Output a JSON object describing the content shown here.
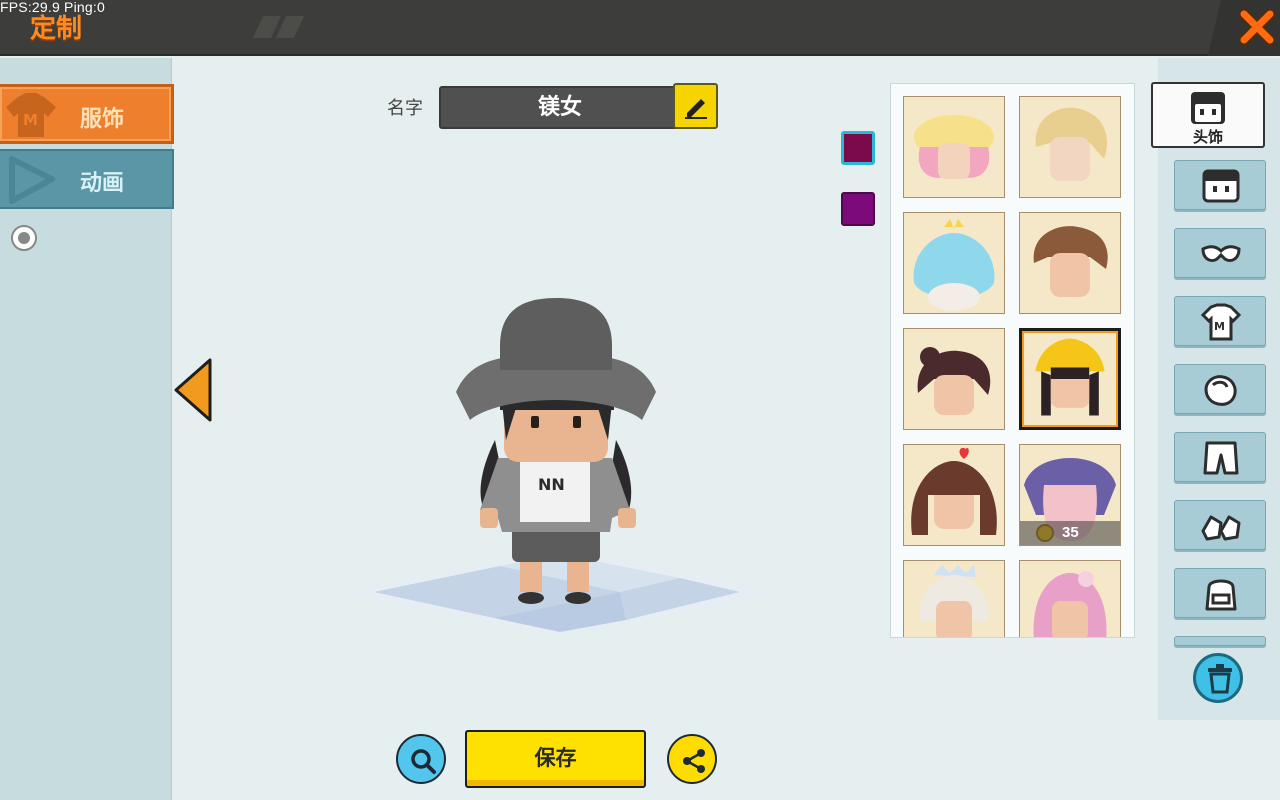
{
  "debug": {
    "fps_text": "FPS:29.9  Ping:0"
  },
  "header": {
    "title": "定制"
  },
  "sidebar": {
    "tabs": [
      {
        "label": "服饰"
      },
      {
        "label": "动画"
      }
    ]
  },
  "character": {
    "name_label": "名字",
    "name_value": "镁女"
  },
  "colors": {
    "swatch_1": "#7a0a4a",
    "swatch_2": "#7c0a7a",
    "accent": "#ee7f2d"
  },
  "items": {
    "price": "35"
  },
  "categories": {
    "active_label": "头饰",
    "icons": [
      "face-icon",
      "mask-icon",
      "shirt-icon",
      "gloves-icon",
      "pants-icon",
      "shoes-icon",
      "backpack-icon"
    ]
  },
  "actions": {
    "save_label": "保存"
  }
}
